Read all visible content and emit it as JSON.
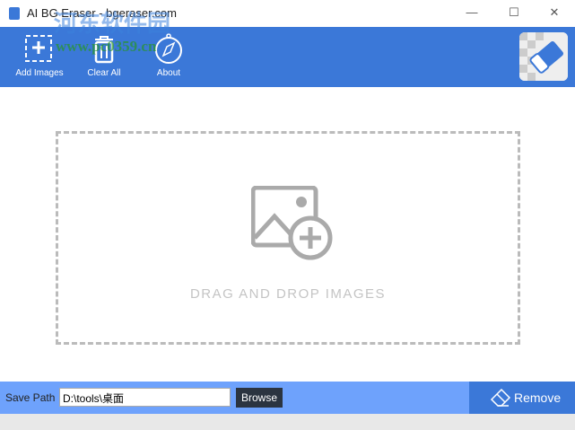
{
  "window": {
    "title": "AI BG Eraser - bgeraser.com",
    "minimize": "—",
    "maximize": "☐",
    "close": "✕"
  },
  "toolbar": {
    "add_images": "Add Images",
    "clear_all": "Clear All",
    "about": "About"
  },
  "dropzone": {
    "text": "DRAG AND DROP IMAGES"
  },
  "bottom": {
    "save_path_label": "Save Path",
    "save_path_value": "D:\\tools\\桌面",
    "browse": "Browse",
    "remove": "Remove"
  },
  "watermark": {
    "line1": "河东软件园",
    "line2": "www.pc0359.cn"
  },
  "colors": {
    "accent": "#3b78d8",
    "bottom_bar": "#6ea2fc",
    "browse": "#2b3440"
  }
}
